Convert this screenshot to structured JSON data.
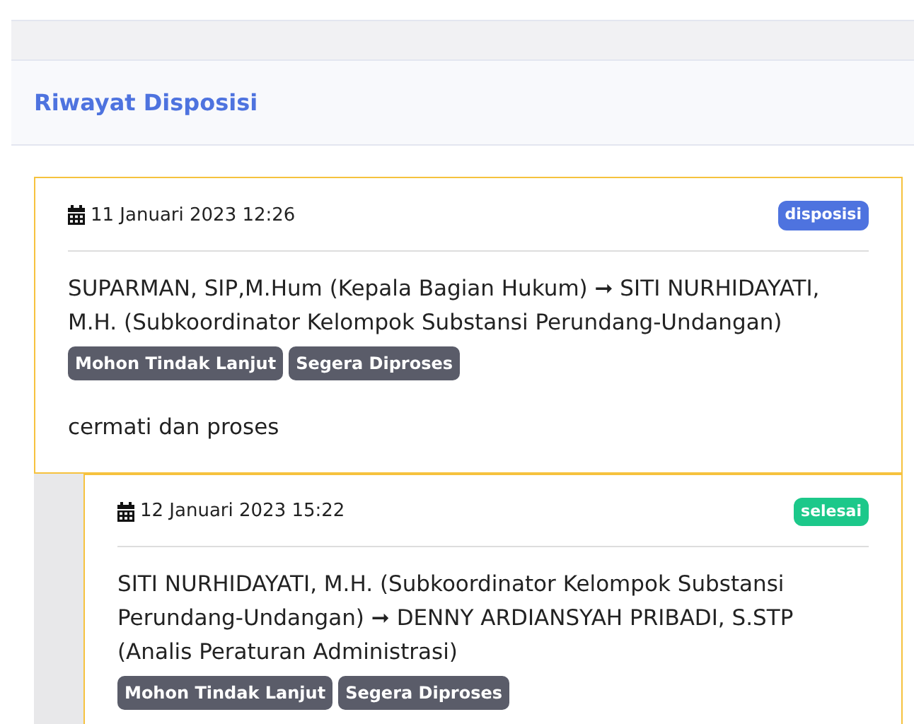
{
  "panel": {
    "title": "Riwayat Disposisi"
  },
  "entries": [
    {
      "date": "11 Januari 2023 12:26",
      "type": {
        "label": "disposisi",
        "kind": "disposisi"
      },
      "route": "SUPARMAN, SIP,M.Hum (Kepala Bagian Hukum) ➞ SITI NURHIDAYATI, M.H. (Subkoordinator Kelompok Substansi Perundang-Undangan)",
      "tags": [
        "Mohon Tindak Lanjut",
        "Segera Diproses"
      ],
      "note": "cermati dan proses",
      "children": [
        {
          "date": "12 Januari 2023 15:22",
          "type": {
            "label": "selesai",
            "kind": "selesai"
          },
          "route": "SITI NURHIDAYATI, M.H. (Subkoordinator Kelompok Substansi Perundang-Undangan) ➞ DENNY ARDIANSYAH PRIBADI, S.STP (Analis Peraturan Administrasi)",
          "tags": [
            "Mohon Tindak Lanjut",
            "Segera Diproses"
          ]
        }
      ]
    }
  ]
}
